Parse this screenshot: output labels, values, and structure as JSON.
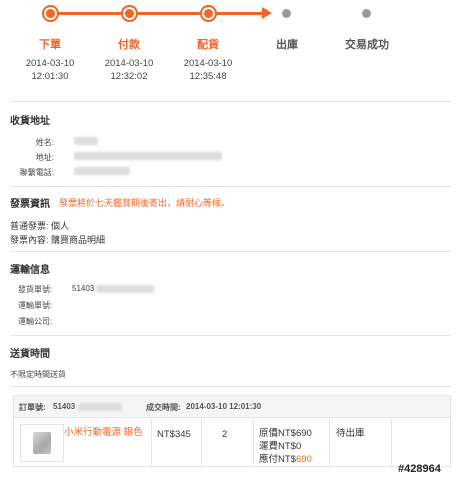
{
  "progress": {
    "steps": [
      {
        "label": "下單",
        "date": "2014-03-10",
        "time": "12:01:30"
      },
      {
        "label": "付款",
        "date": "2014-03-10",
        "time": "12:32:02"
      },
      {
        "label": "配貨",
        "date": "2014-03-10",
        "time": "12:35:48"
      },
      {
        "label": "出庫"
      },
      {
        "label": "交易成功"
      }
    ]
  },
  "address": {
    "title": "收貨地址",
    "name_label": "姓名:",
    "addr_label": "地址:",
    "phone_label": "聯繫電話:"
  },
  "invoice": {
    "title": "發票資訊",
    "notice": "發票將於七天鑑賞期後寄出，請耐心等候。",
    "type_line": "普通發票:  個人",
    "content_line": "發票內容:  購買商品明細"
  },
  "shipping": {
    "title": "運輸信息",
    "tracking_label": "發貨單號:",
    "tracking_prefix": "51403",
    "waybill_label": "運輸單號:",
    "company_label": "運輸公司:"
  },
  "delivery": {
    "title": "送貨時間",
    "value": "不限定時間送貨"
  },
  "order": {
    "number_label": "訂單號:",
    "number_prefix": "51403",
    "time_label": "成交時間:",
    "time_value": "2014-03-10 12:01:30",
    "product_name": "小米行動電源 銀色",
    "unit_price": "NT$345",
    "quantity": "2",
    "original_price": "原價NT$690",
    "shipping_fee": "運費NT$0",
    "payable_label": "應付NT$",
    "payable_value": "690",
    "status": "待出庫"
  },
  "watermark": "#428964",
  "colors": {
    "accent": "#f26522",
    "pending": "#999999"
  }
}
